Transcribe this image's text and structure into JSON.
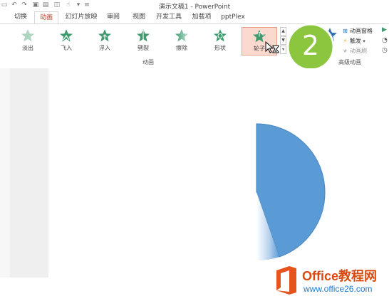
{
  "window": {
    "title": "演示文稿1 - PowerPoint"
  },
  "qat": {
    "icons": [
      "save-icon",
      "undo-icon",
      "redo-icon",
      "start-from-beginning-icon",
      "touch-mode-icon",
      "customize-qat-icon"
    ]
  },
  "tabs": [
    {
      "label": "切换"
    },
    {
      "label": "动画"
    },
    {
      "label": "幻灯片放映"
    },
    {
      "label": "审阅"
    },
    {
      "label": "视图"
    },
    {
      "label": "开发工具"
    },
    {
      "label": "加载项"
    },
    {
      "label": "pptPlex"
    }
  ],
  "ribbon": {
    "animation_gallery": {
      "effects": [
        {
          "label": "淡出",
          "icon": "fade-star-icon"
        },
        {
          "label": "飞入",
          "icon": "fly-in-star-icon"
        },
        {
          "label": "浮入",
          "icon": "float-in-star-icon"
        },
        {
          "label": "劈裂",
          "icon": "split-star-icon"
        },
        {
          "label": "擦除",
          "icon": "wipe-star-icon"
        },
        {
          "label": "形状",
          "icon": "shape-star-icon"
        },
        {
          "label": "轮子",
          "icon": "wheel-star-icon",
          "selected": true
        }
      ],
      "group_label": "动画"
    },
    "advanced": {
      "items": [
        {
          "label": "动画窗格",
          "icon": "animation-pane-icon"
        },
        {
          "label": "触发",
          "icon": "trigger-icon"
        },
        {
          "label": "动画刷",
          "icon": "animation-painter-icon"
        }
      ],
      "group_label": "高级动画"
    }
  },
  "callout": {
    "number": "2"
  },
  "watermark": {
    "brand": "Office教程网",
    "url": "www.office26.com"
  },
  "colors": {
    "accent_tab": "#c4361f",
    "shape_fill": "#5b9bd5",
    "callout": "#8cc63f",
    "selected_effect": "#fbd9cf"
  }
}
